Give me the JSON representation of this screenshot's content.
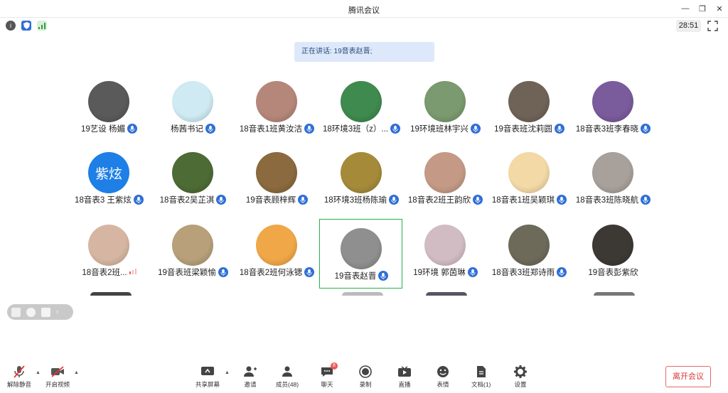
{
  "window": {
    "title": "腾讯会议",
    "minimize": "—",
    "restore": "❐",
    "close": "✕"
  },
  "infobar": {
    "timer": "28:51",
    "info_icon": "info-icon",
    "shield_icon": "shield-icon",
    "signal_icon": "signal-icon"
  },
  "speaking": {
    "text": "正在讲话: 19音表赵晋;"
  },
  "participants": [
    {
      "name": "19艺设 杨媚",
      "avatar": "#5a5a5a",
      "mic": true
    },
    {
      "name": "杨茜书记",
      "avatar": "#cfeaf2",
      "mic": true
    },
    {
      "name": "18音表1班黄汝洁",
      "avatar": "#b5877a",
      "mic": true
    },
    {
      "name": "18环境3班（z）...",
      "avatar": "#3f8a4e",
      "mic": true
    },
    {
      "name": "19环境班林宇兴",
      "avatar": "#7b9a6f",
      "mic": true
    },
    {
      "name": "19音表班沈莉圆",
      "avatar": "#6f6357",
      "mic": true
    },
    {
      "name": "18音表3班李春晓",
      "avatar": "#7a5b9c",
      "mic": true
    },
    {
      "name": "18音表3 王紫炫",
      "avatar": "#1e7fe6",
      "avatar_text": "紫炫",
      "mic": true
    },
    {
      "name": "18音表2吴芷淇",
      "avatar": "#4d6b35",
      "mic": true
    },
    {
      "name": "19音表顾梓辉",
      "avatar": "#8a6a3e",
      "mic": true
    },
    {
      "name": "18环境3班杨陈瑜",
      "avatar": "#a58a3a",
      "mic": true
    },
    {
      "name": "18音表2班王韵欣",
      "avatar": "#c49a86",
      "mic": true
    },
    {
      "name": "18音表1班吴颖琪",
      "avatar": "#f3d9a6",
      "mic": true
    },
    {
      "name": "18音表3班陈晓航",
      "avatar": "#a7a09b",
      "mic": true
    },
    {
      "name": "18音表2班...",
      "avatar": "#d6b6a2",
      "mic": false,
      "level": true
    },
    {
      "name": "19音表班梁颖愉",
      "avatar": "#b7a07a",
      "mic": true
    },
    {
      "name": "18音表2班何泳锶",
      "avatar": "#f0a748",
      "mic": true
    },
    {
      "name": "19音表赵晋",
      "avatar": "#8f8f8f",
      "mic": true,
      "highlight": true
    },
    {
      "name": "19环境 郭茵琳",
      "avatar": "#d2bcc4",
      "mic": true
    },
    {
      "name": "18音表3班郑诗雨",
      "avatar": "#6d6a5a",
      "mic": true
    },
    {
      "name": "19音表彭紫欣",
      "avatar": "#3c3935",
      "mic": false
    }
  ],
  "toolbar": {
    "unmute": "解除静音",
    "start_video": "开启视频",
    "share": "共享屏幕",
    "invite": "邀请",
    "members": "成员(48)",
    "chat": "聊天",
    "chat_badge": "8",
    "record": "录制",
    "live": "直播",
    "emoji": "表情",
    "docs": "文档(1)",
    "settings": "设置",
    "leave": "离开会议"
  },
  "colors": {
    "accent": "#2f6fd6",
    "speaking_bg": "#dde9fa",
    "highlight": "#22b14c",
    "leave": "#d63a3a"
  }
}
